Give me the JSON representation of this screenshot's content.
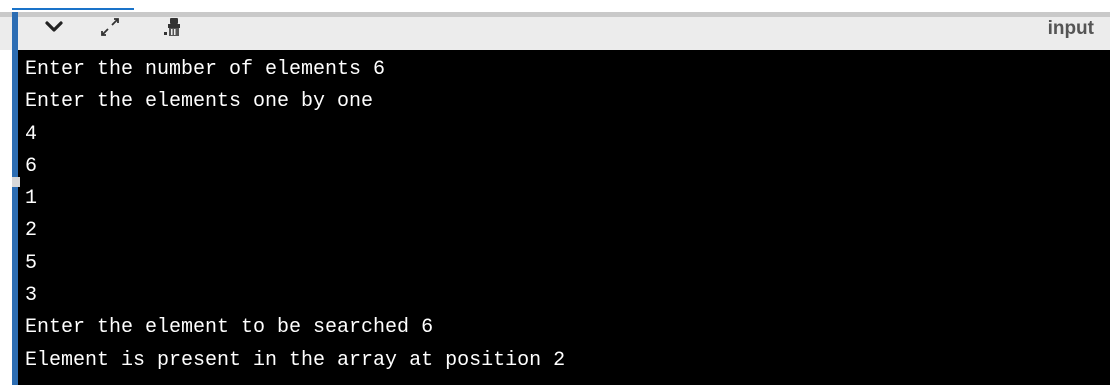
{
  "toolbar": {
    "icons": [
      "chevron-down-icon",
      "expand-icon",
      "clear-icon"
    ],
    "input_label": "input"
  },
  "terminal": {
    "lines": [
      "Enter the number of elements 6",
      "Enter the elements one by one",
      "4",
      "6",
      "1",
      "2",
      "5",
      "3",
      "Enter the element to be searched 6",
      "Element is present in the array at position 2"
    ]
  },
  "colors": {
    "terminal_bg": "#000000",
    "terminal_text": "#ffffff",
    "toolbar_bg": "#ececec",
    "accent": "#2c6db3"
  }
}
